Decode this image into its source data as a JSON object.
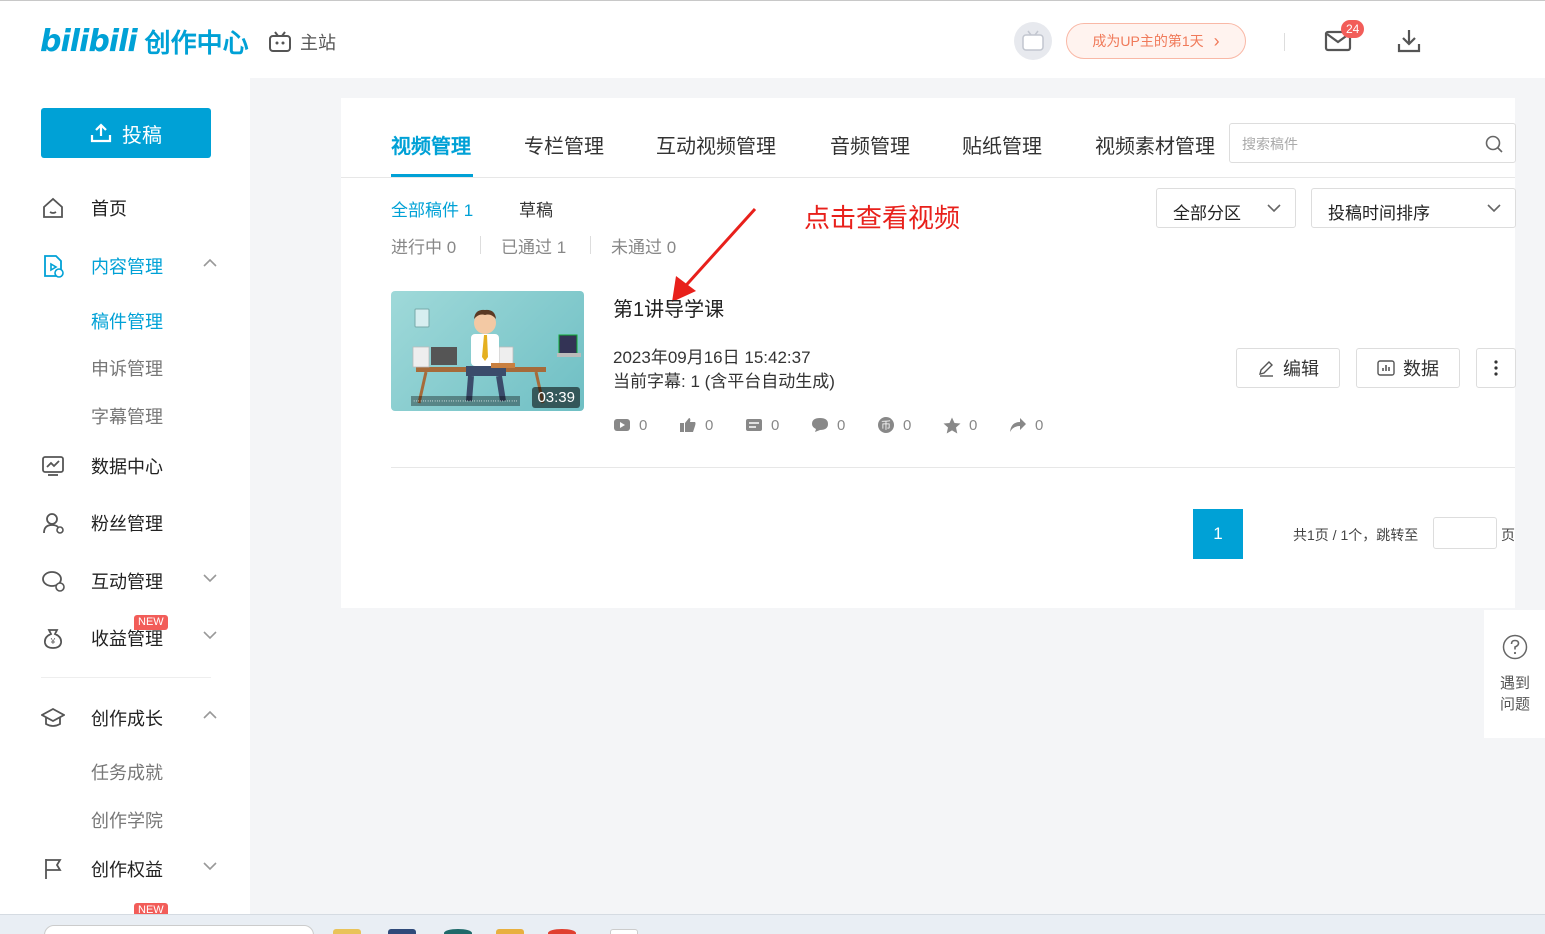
{
  "header": {
    "logo_bili": "bilibili",
    "logo_text": "创作中心",
    "main_site": "主站",
    "up_badge": "成为UP主的第1天",
    "mail_count": "24"
  },
  "sidebar": {
    "upload_label": "投稿",
    "items": {
      "home": "首页",
      "content": "内容管理",
      "manuscripts": "稿件管理",
      "appeals": "申诉管理",
      "subtitles": "字幕管理",
      "data": "数据中心",
      "fans": "粉丝管理",
      "interaction": "互动管理",
      "revenue": "收益管理",
      "growth": "创作成长",
      "tasks": "任务成就",
      "academy": "创作学院",
      "rights": "创作权益"
    },
    "new_tag": "NEW"
  },
  "tabs": [
    "视频管理",
    "专栏管理",
    "互动视频管理",
    "音频管理",
    "贴纸管理",
    "视频素材管理"
  ],
  "search": {
    "placeholder": "搜索稿件"
  },
  "filters": {
    "all": "全部稿件 1",
    "drafts": "草稿",
    "in_progress": "进行中 0",
    "passed": "已通过 1",
    "rejected": "未通过 0",
    "zone": "全部分区",
    "sort": "投稿时间排序"
  },
  "annotation": "点击查看视频",
  "video": {
    "title": "第1讲导学课",
    "time": "2023年09月16日 15:42:37",
    "subtitle_info": "当前字幕: 1 (含平台自动生成)",
    "duration": "03:39",
    "stats": [
      "0",
      "0",
      "0",
      "0",
      "0",
      "0",
      "0"
    ],
    "edit": "编辑",
    "data": "数据"
  },
  "pagination": {
    "current": "1",
    "info": "共1页 / 1个，跳转至",
    "suffix": "页"
  },
  "help": "遇到问题",
  "colors": {
    "accent": "#00a1d6",
    "annotation": "#e8201b",
    "badge": "#f25d59"
  }
}
